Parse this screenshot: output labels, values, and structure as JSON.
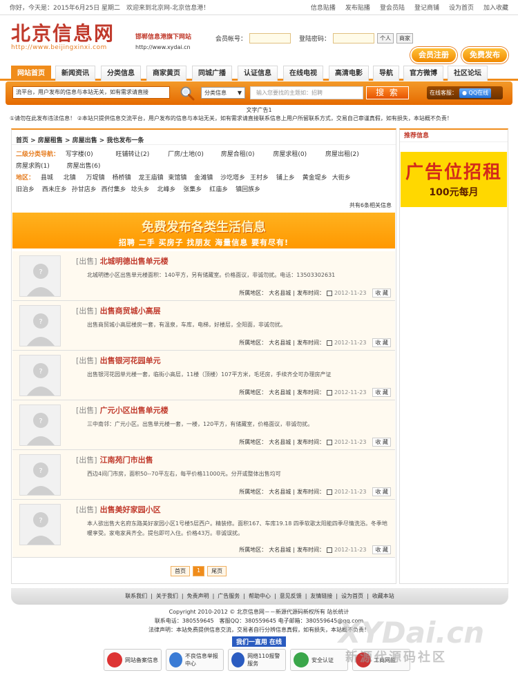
{
  "topbar": {
    "greeting": "你好，今天是：2015年6月25日 星期二　欢迎来到北京网-北京信息港！",
    "links": [
      "信息贴播",
      "发布贴播",
      "登会员陆",
      "登记商铺",
      "设为首页",
      "加入收藏"
    ]
  },
  "header": {
    "logo_cn": "北京信息网",
    "logo_en": "http://www.beijingxinxi.com",
    "slogan": "邯郸信息港旗下网站",
    "site_url": "http://www.xydai.cn",
    "account_label": "会员帐号：",
    "password_label": "登陆密码：",
    "personal_btn": "个人",
    "business_btn": "商家",
    "register_btn": "会员注册",
    "post_btn": "免费发布"
  },
  "nav": [
    "网站首页",
    "新闻资讯",
    "分类信息",
    "商家黄页",
    "同城广播",
    "认证信息",
    "在线电视",
    "高清电影",
    "导航",
    "官方微博",
    "社区论坛"
  ],
  "search": {
    "notice": "流平台，用户发布的信息与本站无关，如有需求请直接",
    "select": "分类信息",
    "placeholder": "输入您要找的主题如：招聘",
    "button": "搜 索",
    "service_label": "在线客服：",
    "qq": "QQ在线"
  },
  "ad_text": "文字广告1",
  "warning": "①请勿在此发布违法信息！ ②本站只提供信息交流平台，用户发布的信息与本站无关，如有需求请直接联系信息上用户所留联系方式，交易自己审谨真假，如有损失，本站概不负责！",
  "breadcrumb": "首页 > 房屋租售 > 房屋出售 > 我也发布一条",
  "category_label": "二级分类导航：",
  "categories": [
    "写字楼(0)",
    "旺铺转让(2)",
    "厂房/土地(0)",
    "房屋合租(0)",
    "房屋求租(0)",
    "房屋出租(2)",
    "房屋求购(1)",
    "房屋出售(6)"
  ],
  "region_label": "地区：",
  "regions": [
    "县城",
    "北镇",
    "万堤镇",
    "杨桥镇",
    "龙王庙镇",
    "束馆镇",
    "金滩镇",
    "沙圪塔乡",
    "王村乡",
    "铺上乡",
    "黄金堤乡",
    "大街乡",
    "旧治乡",
    "西未庄乡",
    "孙甘店乡",
    "西付集乡",
    "埝头乡",
    "北峰乡",
    "张集乡",
    "红庙乡",
    "镇回族乡"
  ],
  "count_text": "共有6条相关信息",
  "banner": {
    "line1": "免费发布各类生活信息",
    "line2": "招聘 二手 买房子 找朋友 海量信息 要有尽有!"
  },
  "listings": [
    {
      "tag": "[出售]",
      "title": "北城明德出售单元楼",
      "desc": "北城明德小区出售单元楼面积：140平方，另有储藏室。价格面议，非诚勿扰。电话：13503302631",
      "area_label": "所属地区：",
      "area": "大名县城",
      "time_label": "发布时间：",
      "date": "2012-11-23",
      "fav": "收 藏"
    },
    {
      "tag": "[出售]",
      "title": "出售商贸城小高层",
      "desc": "出售商贸城小高层楼房一套，有温泉，车库，电梯，好楼层，全阳面，非诚勿扰。",
      "area_label": "所属地区：",
      "area": "大名县城",
      "time_label": "发布时间：",
      "date": "2012-11-23",
      "fav": "收 藏"
    },
    {
      "tag": "[出售]",
      "title": "出售银河花园单元",
      "desc": "出售银河花园单元楼一套，临街小高层，11楼（顶楼）107平方米，毛坯房，手续齐全可办理房产证",
      "area_label": "所属地区：",
      "area": "大名县城",
      "time_label": "发布时间：",
      "date": "2012-11-23",
      "fav": "收 藏"
    },
    {
      "tag": "[出售]",
      "title": "广元小区出售单元楼",
      "desc": "三中南邻：广元小区。出售单元楼一套，一楼，120平方，有储藏室，价格面议，非诚勿扰。",
      "area_label": "所属地区：",
      "area": "大名县城",
      "time_label": "发布时间：",
      "date": "2012-11-23",
      "fav": "收 藏"
    },
    {
      "tag": "[出售]",
      "title": "江南苑门市出售",
      "desc": "西边4间门市房，面积50--70平左右，每平价格11000元。分开或整体出售均可",
      "area_label": "所属地区：",
      "area": "大名县城",
      "time_label": "发布时间：",
      "date": "2012-11-23",
      "fav": "收 藏"
    },
    {
      "tag": "[出售]",
      "title": "出售美好家园小区",
      "desc": "本人欲出售大名府东路美好家园小区1号楼5层西户。精装修。面积167、车库19.18 四季软歌太阳能四季尽情洗浴。冬季地暖享受。家电家具齐全。提包即可入住。价格43万。非诚误扰。",
      "area_label": "所属地区：",
      "area": "大名县城",
      "time_label": "发布时间：",
      "date": "2012-11-23",
      "fav": "收 藏"
    }
  ],
  "pager": {
    "first": "首页",
    "current": "1",
    "last": "尾页"
  },
  "sidebar": {
    "title": "推荐信息",
    "ad_line1": "广告位招租",
    "ad_line2": "100元每月"
  },
  "footer": {
    "links": [
      "联系我们",
      "关于我们",
      "免责声明",
      "广告服务",
      "帮助中心",
      "意见反馈",
      "友情链接",
      "设为首页",
      "收藏本站"
    ],
    "copyright": "Copyright 2010-2012 © 北京信息网－－新源代源码新权所有 站长统计",
    "contact": "联系电话：380559645　客服QQ：380559645 电子邮箱：380559645@qq.com",
    "legal": "法律声明：本站免费提供信息交流，交易者自行分辨信息真假，如有损失，本站概不负责！",
    "qq_bar": "我们一直用 在线",
    "badges": [
      "网站备案信息",
      "不良信息举报中心",
      "网络110报警服务",
      "安全认证",
      "工商网监"
    ]
  },
  "watermark": {
    "main": "XYDai.cn",
    "sub": "新源代源码社区"
  }
}
